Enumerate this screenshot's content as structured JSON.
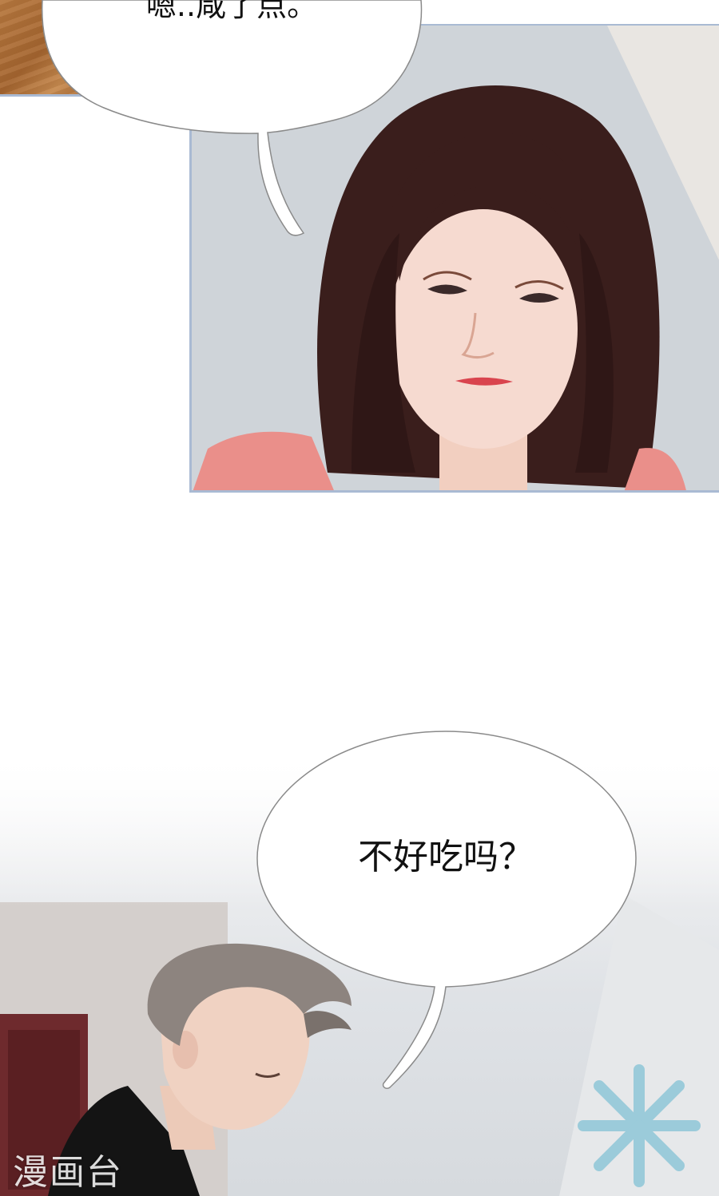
{
  "panels": {
    "top_bubble": {
      "text": "嗯..咸了点。"
    },
    "bottom_bubble": {
      "text": "不好吃吗？"
    }
  },
  "watermark": {
    "text": "漫画台"
  },
  "colors": {
    "panel_border": "#a9bad3",
    "bubble_fill": "#ffffff",
    "bubble_stroke": "#8a8a8a",
    "text": "#111111"
  }
}
